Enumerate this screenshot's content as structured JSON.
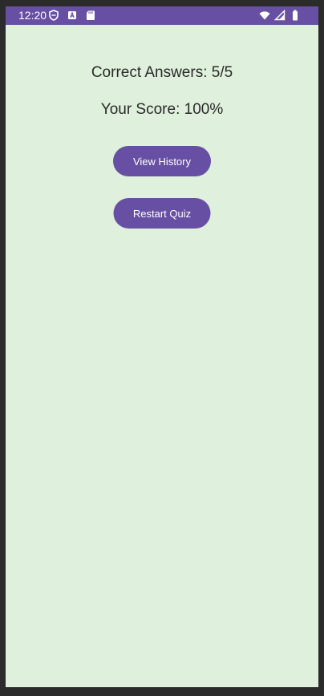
{
  "status_bar": {
    "time": "12:20",
    "left_icons": [
      "shield-icon",
      "keyboard-a-icon",
      "sd-card-icon"
    ],
    "right_icons": [
      "wifi-icon",
      "signal-icon",
      "battery-icon"
    ],
    "color": "#6750a4"
  },
  "results": {
    "correct_answers": "Correct Answers: 5/5",
    "score": "Your Score: 100%"
  },
  "buttons": {
    "view_history": "View History",
    "restart_quiz": "Restart Quiz"
  },
  "colors": {
    "accent": "#6750a4",
    "background": "#dff0dc",
    "text": "#2a2a2a"
  }
}
